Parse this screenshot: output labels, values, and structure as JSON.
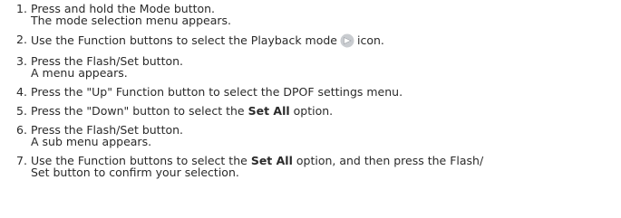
{
  "steps": [
    {
      "num": "1.",
      "line1": "Press and hold the Mode button.",
      "line2": "The mode selection menu appears."
    },
    {
      "num": "2.",
      "text_before_icon": "Use the Function buttons to select the Playback mode",
      "icon": "playback-mode-icon",
      "text_after_icon": "icon."
    },
    {
      "num": "3.",
      "line1": "Press the Flash/Set button.",
      "line2": "A menu appears."
    },
    {
      "num": "4.",
      "line1": "Press the \"Up\" Function button to select the DPOF settings menu."
    },
    {
      "num": "5.",
      "text_before_bold": "Press the \"Down\" button to select the",
      "bold": "Set All",
      "text_after_bold": "option."
    },
    {
      "num": "6.",
      "line1": "Press the Flash/Set button.",
      "line2": "A sub menu appears."
    },
    {
      "num": "7.",
      "text_before_bold": "Use the Function buttons to select the",
      "bold": "Set All",
      "text_after_bold": "option, and then press the Flash/",
      "line2": "Set button to confirm your selection."
    }
  ],
  "colors": {
    "text": "#2a2a2a",
    "icon_fill": "#c9ccd0",
    "icon_arrow": "#ffffff"
  }
}
